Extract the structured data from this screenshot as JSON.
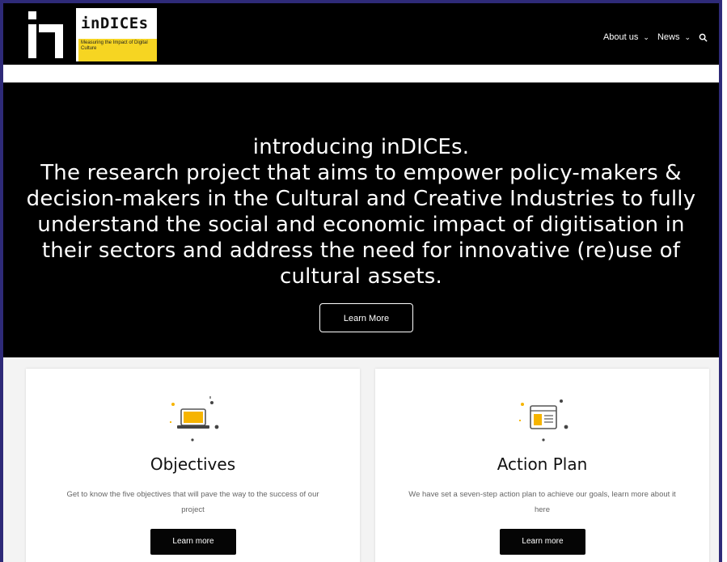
{
  "header": {
    "logo_title": "inDICEs",
    "logo_tagline": "Measuring the Impact of Digital Culture",
    "nav": [
      {
        "label": "About us"
      },
      {
        "label": "News"
      }
    ],
    "search_icon": "search-icon"
  },
  "hero": {
    "title": "introducing inDICEs.",
    "body": "The research project that aims to empower policy-makers & decision-makers in the Cultural and Creative Industries to fully understand the social and economic impact of digitisation in their sectors and address the need for innovative (re)use of cultural assets.",
    "button_label": "Learn More"
  },
  "cards": [
    {
      "title": "Objectives",
      "description": "Get to know the five objectives that will pave the way to the success of our project",
      "button_label": "Learn more",
      "icon": "laptop-icon"
    },
    {
      "title": "Action Plan",
      "description": "We have set a seven-step action plan to achieve our goals, learn more about it here",
      "button_label": "Learn more",
      "icon": "document-icon"
    }
  ],
  "colors": {
    "frame_border": "#2e2a78",
    "logo_accent": "#f6d522",
    "hero_bg": "#000000"
  }
}
